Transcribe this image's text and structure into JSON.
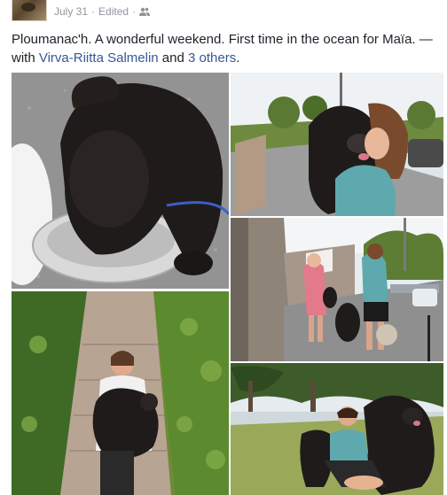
{
  "post": {
    "date": "July 31",
    "dot": "·",
    "edited": "Edited",
    "audience_icon": "friends-icon",
    "caption_text": "Ploumanac'h. A wonderful weekend. First time in the ocean for Maïa.",
    "caption_with": "— with",
    "tagged_person": "Virva-Riitta Salmelin",
    "and_text": "and",
    "others_link": "3 others",
    "period": "."
  },
  "photos": [
    {
      "id": "photo-1",
      "subject": "black puppy drinking from steel bowl"
    },
    {
      "id": "photo-2",
      "subject": "woman carrying black dog on street"
    },
    {
      "id": "photo-3",
      "subject": "two women walking dogs by stone wall"
    },
    {
      "id": "photo-4",
      "subject": "woman holding puppy on garden path"
    },
    {
      "id": "photo-5",
      "subject": "woman with dogs on lawn"
    }
  ]
}
